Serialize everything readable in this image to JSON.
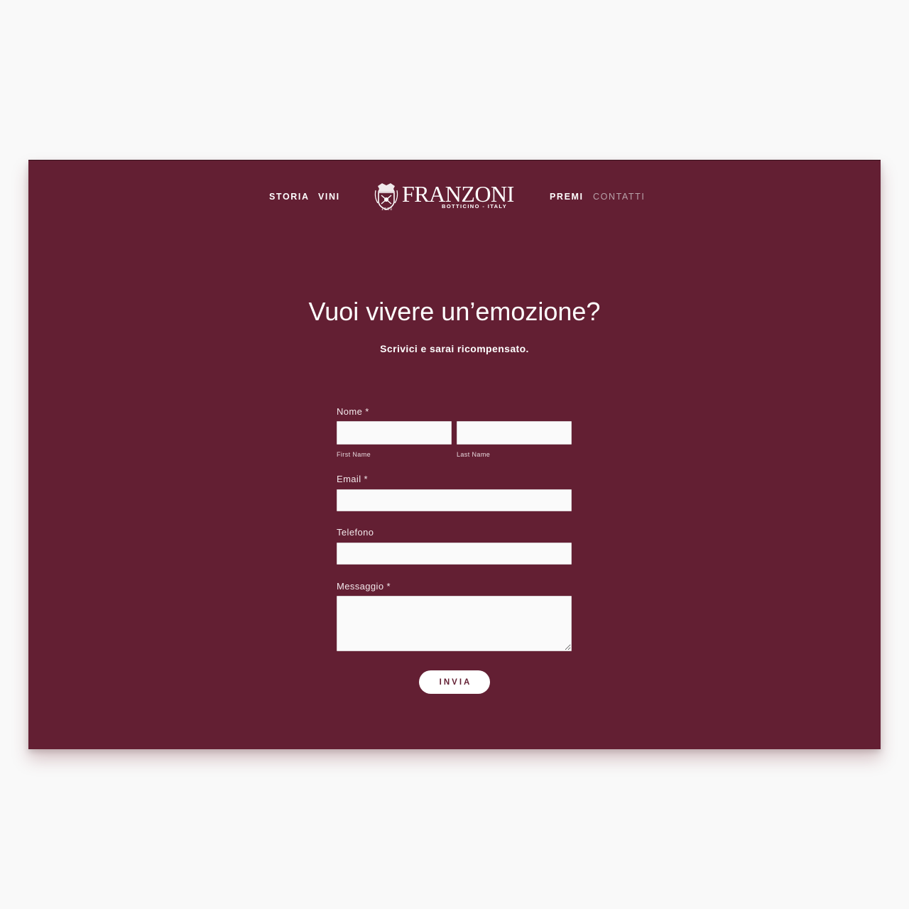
{
  "nav": {
    "left_items": [
      {
        "label": "STORIA"
      },
      {
        "label": "VINI"
      }
    ],
    "right_items": [
      {
        "label": "PREMI"
      },
      {
        "label": "CONTATTI",
        "active": true
      }
    ]
  },
  "logo": {
    "brand": "FRANZONI",
    "tagline": "BOTTICINO - ITALY",
    "year": "1910"
  },
  "hero": {
    "title": "Vuoi vivere un’emozione?",
    "subtitle": "Scrivici e sarai ricompensato."
  },
  "form": {
    "name_label": "Nome *",
    "first_name_sublabel": "First Name",
    "last_name_sublabel": "Last Name",
    "email_label": "Email *",
    "phone_label": "Telefono",
    "message_label": "Messaggio *",
    "first_name_value": "",
    "last_name_value": "",
    "email_value": "",
    "phone_value": "",
    "message_value": "",
    "submit_label": "INVIA"
  },
  "colors": {
    "background": "#f9f9f9",
    "panel": "#631f33",
    "text": "#ffffff",
    "field": "#fafafa"
  }
}
